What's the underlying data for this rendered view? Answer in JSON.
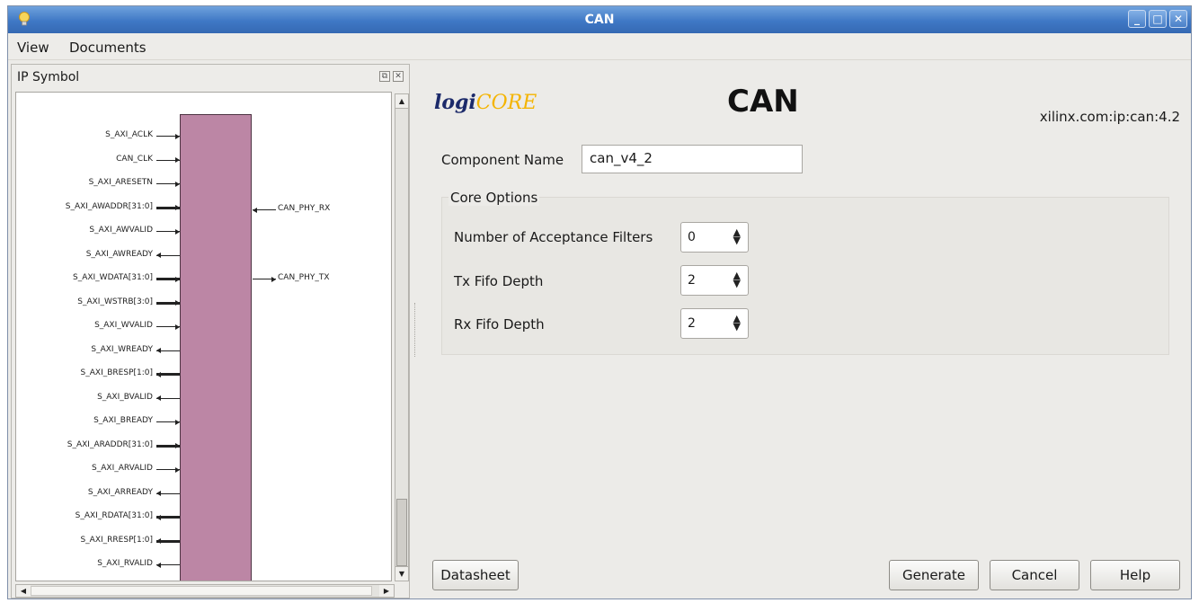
{
  "window": {
    "title": "CAN"
  },
  "menu": {
    "view": "View",
    "documents": "Documents"
  },
  "left_panel": {
    "title": "IP Symbol",
    "left_pins": [
      "S_AXI_ACLK",
      "CAN_CLK",
      "S_AXI_ARESETN",
      "S_AXI_AWADDR[31:0]",
      "S_AXI_AWVALID",
      "S_AXI_AWREADY",
      "S_AXI_WDATA[31:0]",
      "S_AXI_WSTRB[3:0]",
      "S_AXI_WVALID",
      "S_AXI_WREADY",
      "S_AXI_BRESP[1:0]",
      "S_AXI_BVALID",
      "S_AXI_BREADY",
      "S_AXI_ARADDR[31:0]",
      "S_AXI_ARVALID",
      "S_AXI_ARREADY",
      "S_AXI_RDATA[31:0]",
      "S_AXI_RRESP[1:0]",
      "S_AXI_RVALID"
    ],
    "right_pins": [
      "CAN_PHY_RX",
      "CAN_PHY_TX"
    ]
  },
  "header": {
    "logo_prefix": "logi",
    "logo_suffix": "CORE",
    "title": "CAN",
    "vlnv": "xilinx.com:ip:can:4.2"
  },
  "form": {
    "component_name_label": "Component Name",
    "component_name_value": "can_v4_2",
    "core_options_title": "Core Options",
    "acceptance_filters_label": "Number of Acceptance Filters",
    "acceptance_filters_value": "0",
    "tx_fifo_label": "Tx Fifo Depth",
    "tx_fifo_value": "2",
    "rx_fifo_label": "Rx Fifo Depth",
    "rx_fifo_value": "2"
  },
  "buttons": {
    "datasheet": "Datasheet",
    "generate": "Generate",
    "cancel": "Cancel",
    "help": "Help"
  }
}
